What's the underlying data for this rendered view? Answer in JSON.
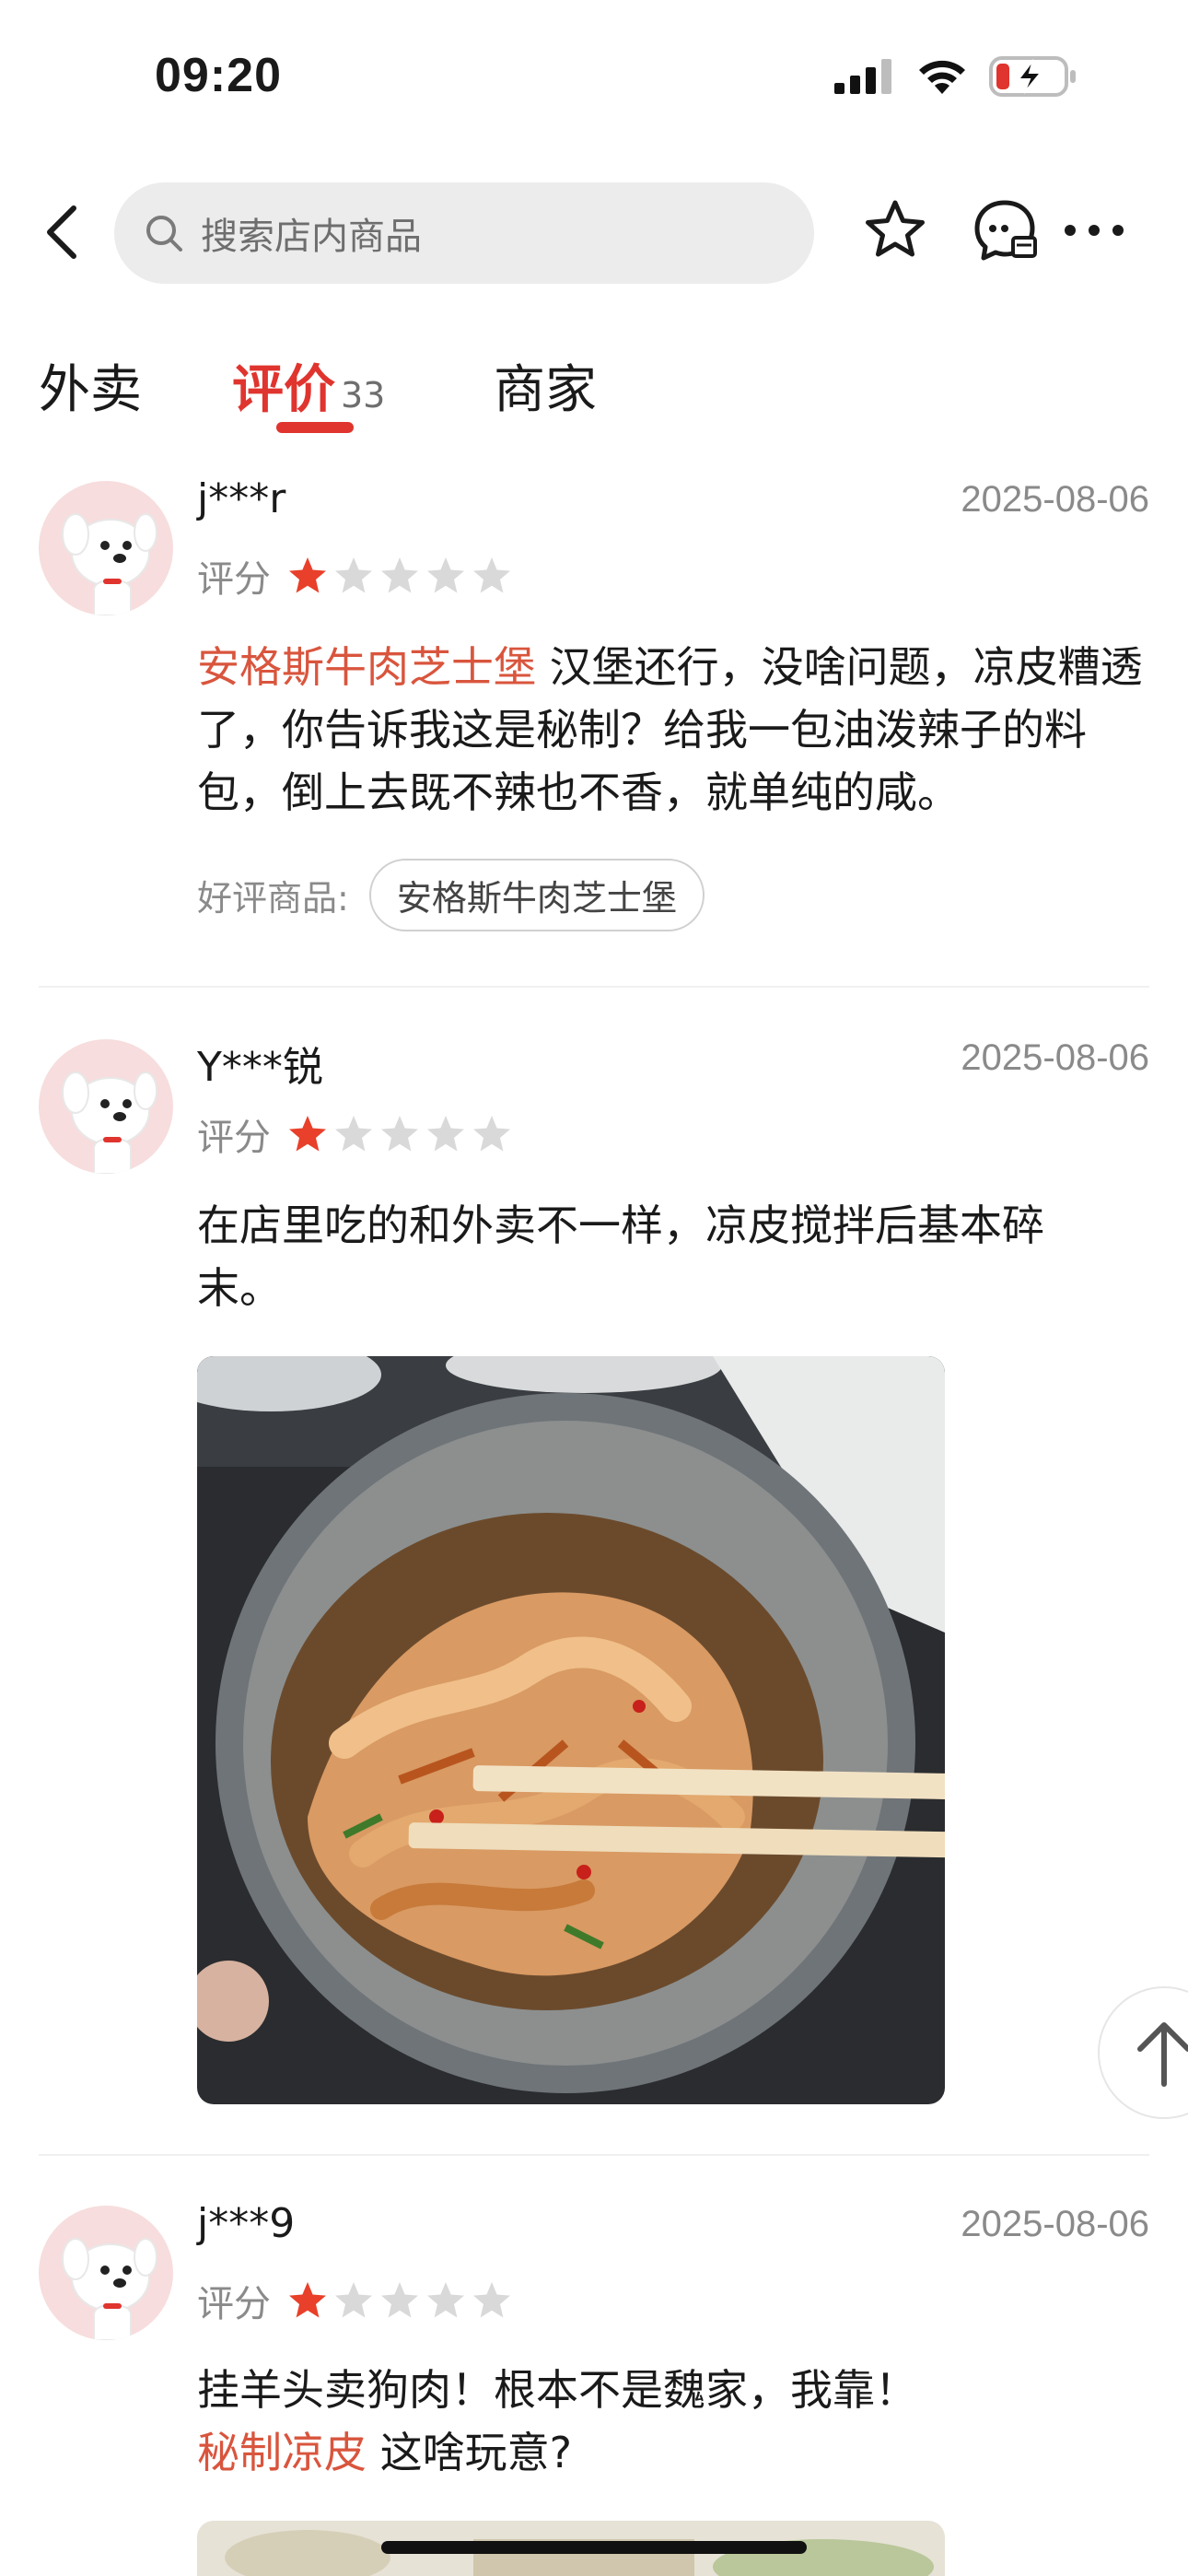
{
  "status_bar": {
    "time": "09:20"
  },
  "header": {
    "search_placeholder": "搜索店内商品"
  },
  "tabs": [
    {
      "label": "外卖"
    },
    {
      "label": "评价",
      "count": "33",
      "active": true
    },
    {
      "label": "商家"
    }
  ],
  "reviews": [
    {
      "user": "j***r",
      "date": "2025-08-06",
      "rating_label": "评分",
      "stars": 1,
      "text_highlight": "安格斯牛肉芝士堡",
      "text": " 汉堡还行，没啥问题，凉皮糟透了，你告诉我这是秘制？给我一包油泼辣子的料包，倒上去既不辣也不香，就单纯的咸。",
      "good_label": "好评商品:",
      "good_item": "安格斯牛肉芝士堡"
    },
    {
      "user": "Y***锐",
      "date": "2025-08-06",
      "rating_label": "评分",
      "stars": 1,
      "text": "在店里吃的和外卖不一样，凉皮搅拌后基本碎末。"
    },
    {
      "user": "j***9",
      "date": "2025-08-06",
      "rating_label": "评分",
      "stars": 1,
      "text": "挂羊头卖狗肉！根本不是魏家，我靠！",
      "text_highlight": "秘制凉皮",
      "text_after": " 这啥玩意?"
    }
  ],
  "colors": {
    "accent": "#e0342e",
    "highlight": "#d9553d",
    "star_on": "#e8402a",
    "star_off": "#d9d9d9"
  }
}
